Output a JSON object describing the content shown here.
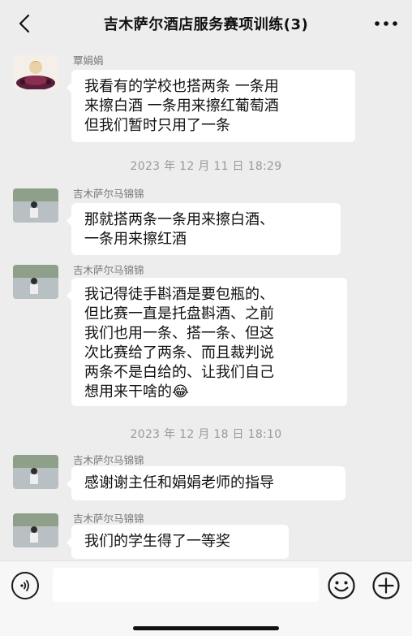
{
  "header": {
    "title": "吉木萨尔酒店服务赛项训练(3)"
  },
  "messages": [
    {
      "sender": "覃娟娟",
      "lines": [
        "我看有的学校也搭两条 一条用",
        "来擦白酒 一条用来擦红葡萄酒",
        "但我们暂时只用了一条"
      ]
    },
    {
      "timestamp": "2023 年 12 月 11 日  18:29"
    },
    {
      "sender": "吉木萨尔马锦锦",
      "lines": [
        "那就搭两条一条用来擦白酒、",
        "一条用来擦红酒"
      ]
    },
    {
      "sender": "吉木萨尔马锦锦",
      "lines": [
        "我记得徒手斟酒是要包瓶的、",
        "但比赛一直是托盘斟酒、之前",
        "我们也用一条、搭一条、但这",
        "次比赛给了两条、而且裁判说",
        "两条不是白给的、让我们自己",
        "想用来干啥的"
      ],
      "emoji": "😂"
    },
    {
      "timestamp": "2023 年 12 月 18 日  18:10"
    },
    {
      "sender": "吉木萨尔马锦锦",
      "lines": [
        "感谢谢主任和娟娟老师的指导"
      ]
    },
    {
      "sender": "吉木萨尔马锦锦",
      "lines": [
        "我们的学生得了一等奖"
      ]
    }
  ],
  "input": {
    "placeholder": ""
  },
  "icons": {
    "back": "chevron-left-icon",
    "more": "more-dots-icon",
    "voice": "voice-icon",
    "emoji": "emoji-icon",
    "plus": "plus-icon"
  },
  "colors": {
    "background": "#ededed",
    "bubble": "#ffffff",
    "timestamp": "#9a9a9a"
  }
}
